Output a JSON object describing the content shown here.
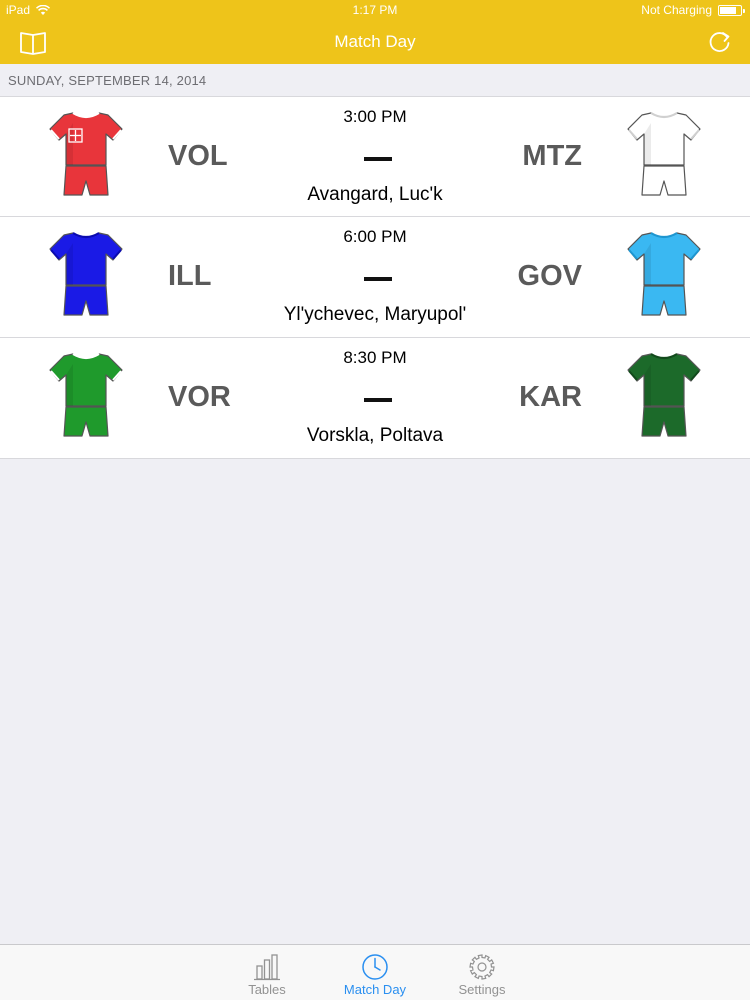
{
  "status_bar": {
    "device": "iPad",
    "time": "1:17 PM",
    "charging": "Not Charging",
    "battery_level": 0.8
  },
  "nav": {
    "title": "Match Day",
    "left_icon": "book-icon",
    "right_icon": "refresh-icon"
  },
  "section": {
    "date": "SUNDAY, SEPTEMBER 14, 2014"
  },
  "matches": [
    {
      "time": "3:00 PM",
      "home": "VOL",
      "away": "MTZ",
      "venue": "Avangard, Luc'k",
      "home_kit": {
        "shirt": "#e8353b",
        "shorts": "#e8353b",
        "trim": "#ffffff",
        "crest": "cross"
      },
      "away_kit": {
        "shirt": "#ffffff",
        "shorts": "#ffffff",
        "trim": "#d0d0d0"
      }
    },
    {
      "time": "6:00 PM",
      "home": "ILL",
      "away": "GOV",
      "venue": "Yl'ychevec, Maryupol'",
      "home_kit": {
        "shirt": "#1a1ae6",
        "shorts": "#1a1ae6",
        "trim": "#0b0bb0"
      },
      "away_kit": {
        "shirt": "#3ab8f2",
        "shorts": "#3ab8f2",
        "trim": "#1e96d0"
      }
    },
    {
      "time": "8:30 PM",
      "home": "VOR",
      "away": "KAR",
      "venue": "Vorskla, Poltava",
      "home_kit": {
        "shirt": "#1f9a2c",
        "shorts": "#1f9a2c",
        "trim": "#ffffff"
      },
      "away_kit": {
        "shirt": "#1c6a2a",
        "shorts": "#1c6a2a",
        "trim": "#124a1c"
      }
    }
  ],
  "tabs": [
    {
      "label": "Tables",
      "icon": "bar-chart-icon",
      "active": false
    },
    {
      "label": "Match Day",
      "icon": "clock-icon",
      "active": true
    },
    {
      "label": "Settings",
      "icon": "gear-icon",
      "active": false
    }
  ],
  "colors": {
    "accent": "#eec41a",
    "tab_active": "#2a8ff0",
    "tab_inactive": "#929292"
  }
}
